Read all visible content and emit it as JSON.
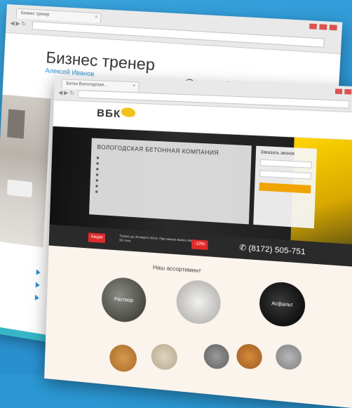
{
  "back_site": {
    "tab_title": "Бизнес тренер",
    "url": "",
    "title": "Бизнес тренер",
    "subtitle": "Алексей Иванов",
    "phone": "",
    "email": ""
  },
  "front_site": {
    "tab_title": "Бетон Вологодская...",
    "url": "",
    "logo": "ВБК",
    "logo_tagline": "",
    "menu": [
      "",
      "",
      "",
      "",
      ""
    ],
    "hero_title": "ВОЛОГОДСКАЯ БЕТОННАЯ КОМПАНИЯ",
    "hero_items": [
      "",
      "",
      "",
      "",
      "",
      "",
      ""
    ],
    "form_title": "Заказать звонок",
    "form_name_placeholder": "",
    "form_phone_placeholder": "",
    "form_button": "",
    "promo_badge": "Акция",
    "promo_text": "Только до 20 марта 2014г. При заказе вывоз свыше 50 тонн",
    "promo_percent": "-10%",
    "phone": "(8172) 505-751",
    "assortment_title": "Наш ассортимент",
    "products": [
      "Раствор",
      "",
      "Асфальт",
      "",
      "",
      "",
      "",
      ""
    ]
  },
  "colors": {
    "background": "#2a97d3",
    "accent_yellow": "#f2c21b",
    "accent_red": "#e02b2b",
    "link_blue": "#2a8fd1"
  }
}
